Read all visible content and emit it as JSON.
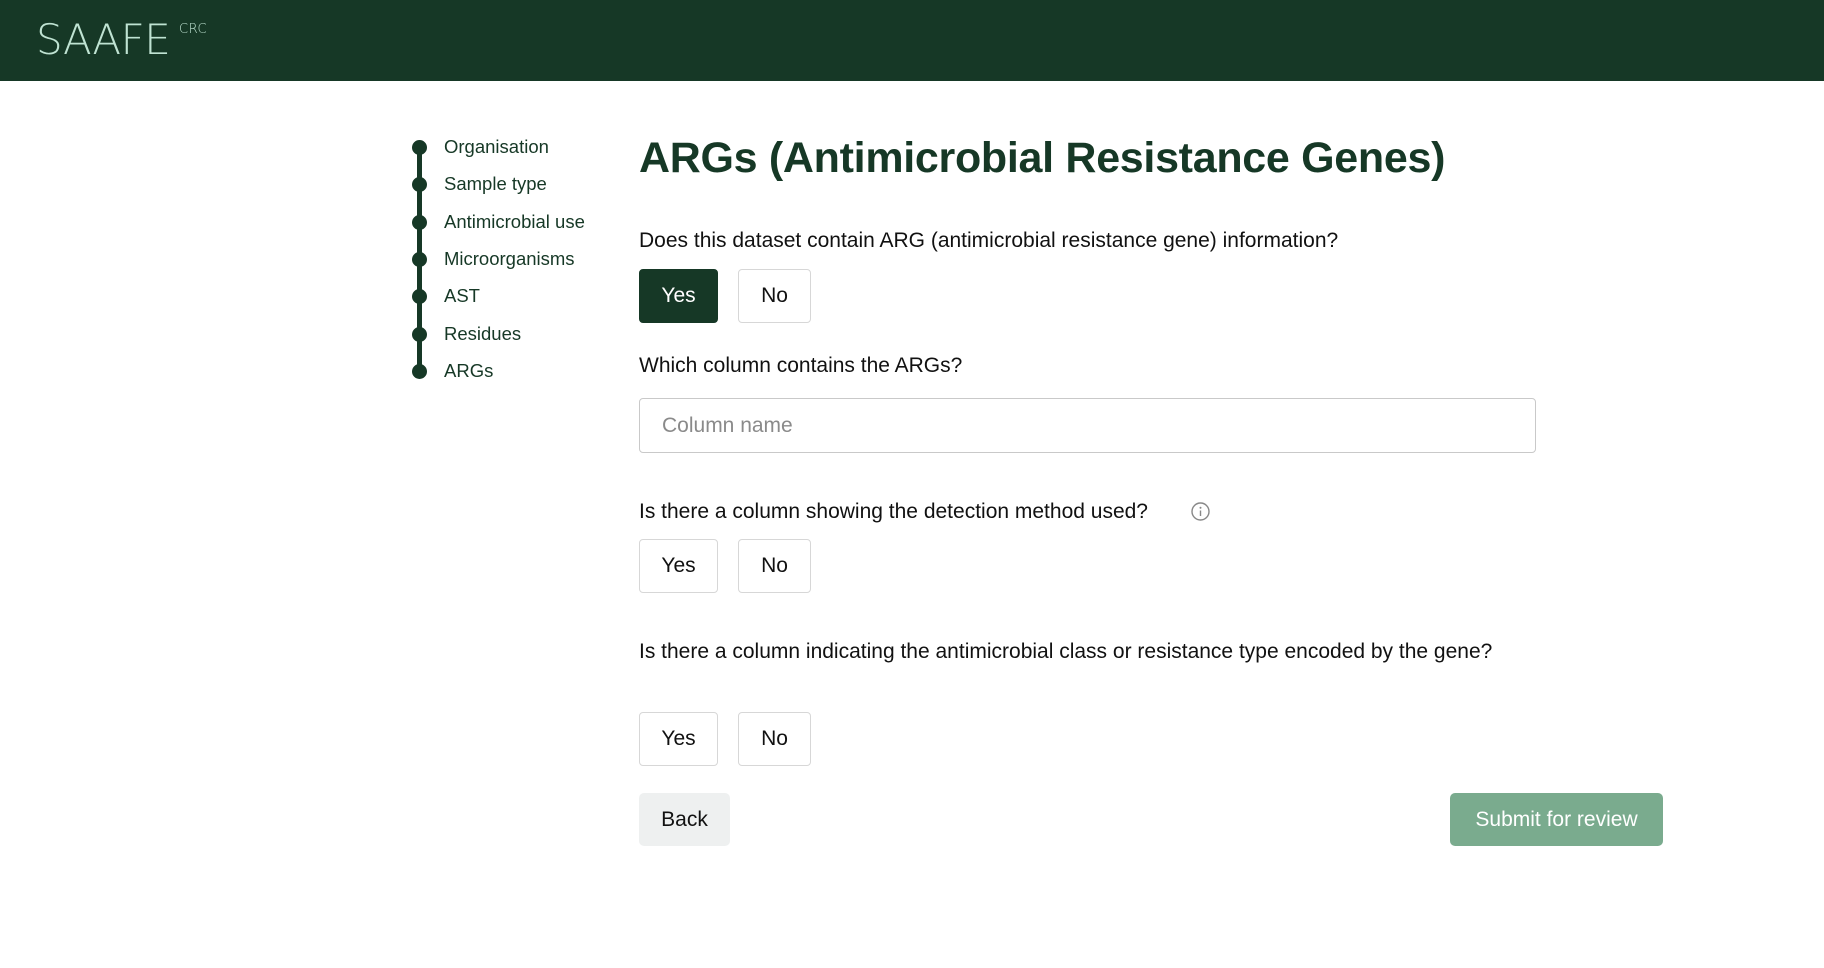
{
  "header": {
    "logo_text": "SAAFE",
    "logo_superscript": "CRC",
    "background_color": "#163826"
  },
  "stepper": {
    "steps": [
      {
        "label": "Organisation"
      },
      {
        "label": "Sample type"
      },
      {
        "label": "Antimicrobial use"
      },
      {
        "label": "Microorganisms"
      },
      {
        "label": "AST"
      },
      {
        "label": "Residues"
      },
      {
        "label": "ARGs"
      }
    ],
    "color": "#163826"
  },
  "main": {
    "title": "ARGs (Antimicrobial Resistance Genes)",
    "questions": [
      {
        "text": "Does this dataset contain ARG (antimicrobial resistance gene) information?",
        "yes_label": "Yes",
        "no_label": "No",
        "selected": "Yes"
      },
      {
        "text": "Which column contains the ARGs?",
        "input_placeholder": "Column name",
        "input_value": ""
      },
      {
        "text": "Is there a column showing the detection method used?",
        "has_info_icon": true,
        "yes_label": "Yes",
        "no_label": "No",
        "selected": ""
      },
      {
        "text": "Is there a column indicating the antimicrobial class or resistance type encoded by the gene?",
        "yes_label": "Yes",
        "no_label": "No",
        "selected": ""
      }
    ],
    "back_label": "Back",
    "submit_label": "Submit for review",
    "colors": {
      "primary": "#163826",
      "submit_disabled": "#7aab8e"
    }
  }
}
